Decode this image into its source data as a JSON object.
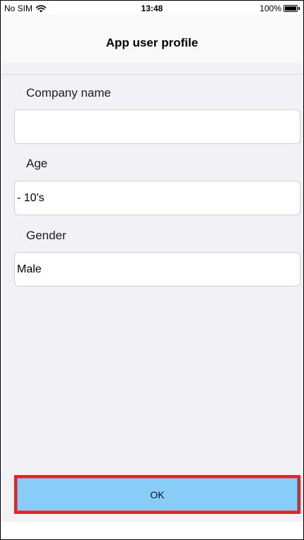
{
  "status_bar": {
    "carrier": "No SIM",
    "time": "13:48",
    "battery": "100%",
    "battery_level_percent": 100,
    "icons": [
      "wifi-icon",
      "battery-icon"
    ]
  },
  "nav": {
    "title": "App user profile"
  },
  "form": {
    "company": {
      "label": "Company name",
      "value": ""
    },
    "age": {
      "label": "Age",
      "value": "- 10's"
    },
    "gender": {
      "label": "Gender",
      "value": "Male"
    }
  },
  "actions": {
    "ok_label": "OK"
  },
  "colors": {
    "background": "#f2f2f6",
    "ok_button": "#87cdf7",
    "highlight_border": "#ef1e1e"
  }
}
